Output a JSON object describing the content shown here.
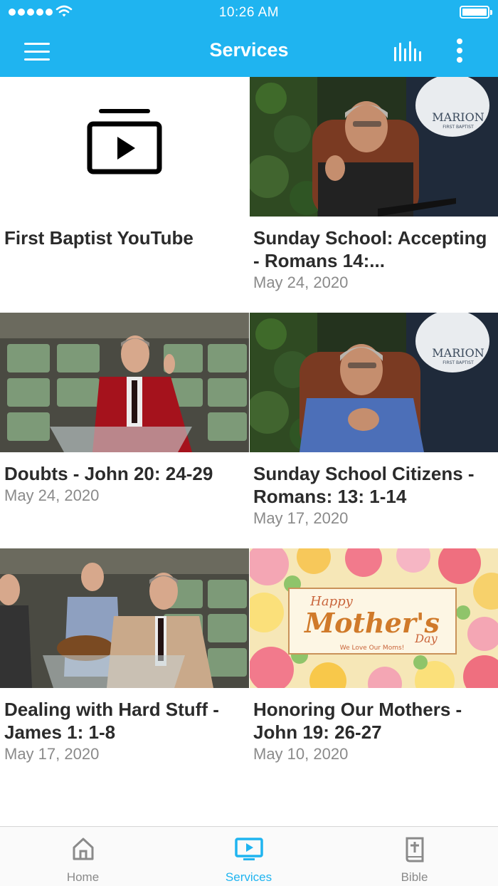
{
  "status_bar": {
    "time": "10:26 AM"
  },
  "header": {
    "title": "Services"
  },
  "colors": {
    "accent": "#1fb4f0",
    "title_text": "#2b2b2b",
    "date_text": "#8a8a8a"
  },
  "items": [
    {
      "title": "First Baptist YouTube",
      "date": "",
      "thumbnail": "youtube-playlist-icon"
    },
    {
      "title": "Sunday School: Accepting - Romans 14:...",
      "date": "May 24, 2020",
      "thumbnail": "speaker-seated-video"
    },
    {
      "title": "Doubts - John 20: 24-29",
      "date": "May 24, 2020",
      "thumbnail": "preacher-pulpit-video"
    },
    {
      "title": "Sunday School Citizens - Romans: 13: 1-14",
      "date": "May 17, 2020",
      "thumbnail": "speaker-seated-video"
    },
    {
      "title": "Dealing with Hard Stuff - James 1: 1-8",
      "date": "May 17, 2020",
      "thumbnail": "preacher-worship-team-video"
    },
    {
      "title": "Honoring Our Mothers - John 19: 26-27",
      "date": "May 10, 2020",
      "thumbnail": "mothers-day-graphic"
    }
  ],
  "thumbnail_text": {
    "church_logo": "MARION",
    "church_logo_sub": "FIRST BAPTIST",
    "mothers_happy": "Happy",
    "mothers_main": "Mother's",
    "mothers_day": "Day",
    "mothers_tagline": "We Love Our Moms!"
  },
  "tabs": [
    {
      "label": "Home",
      "icon": "home-icon"
    },
    {
      "label": "Services",
      "icon": "tv-play-icon",
      "active": true
    },
    {
      "label": "Bible",
      "icon": "bible-icon"
    }
  ]
}
